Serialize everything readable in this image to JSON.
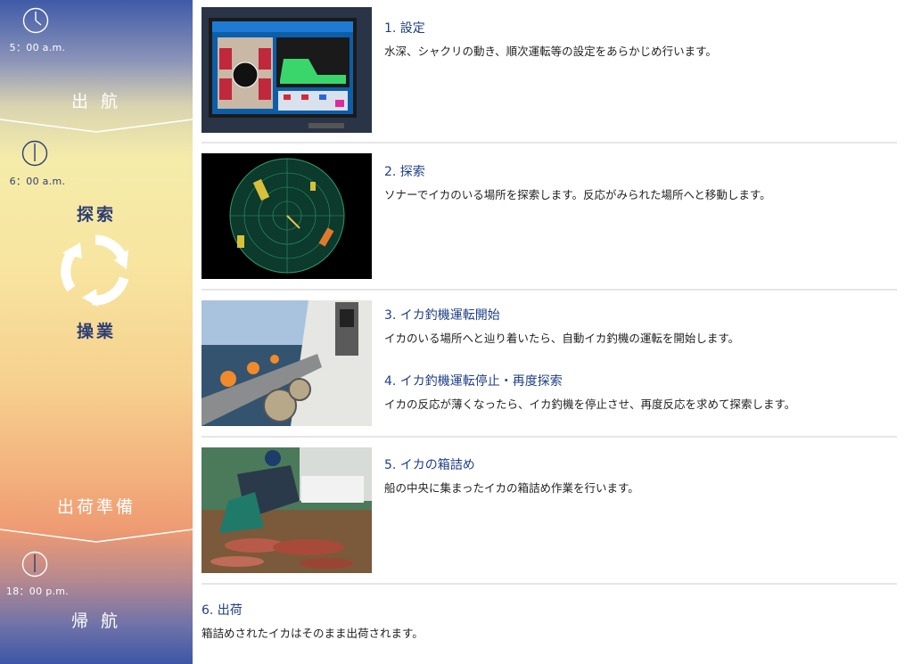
{
  "timeline": {
    "clocks": [
      {
        "time": "5：00 a.m."
      },
      {
        "time": "6：00 a.m."
      },
      {
        "time": "18：00 p.m."
      }
    ],
    "phases": {
      "departure": "出 航",
      "search": "探索",
      "operation": "操業",
      "shipping_prep": "出荷準備",
      "return": "帰 航"
    },
    "cycle_icon": "circular-arrows-icon"
  },
  "steps": [
    {
      "title": "1. 設定",
      "desc": "水深、シャクリの動き、順次運転等の設定をあらかじめ行います。"
    },
    {
      "title": "2. 探索",
      "desc": "ソナーでイカのいる場所を探索します。反応がみられた場所へと移動します。"
    },
    {
      "title": "3. イカ釣機運転開始",
      "desc": "イカのいる場所へと辿り着いたら、自動イカ釣機の運転を開始します。"
    },
    {
      "title": "4. イカ釣機運転停止・再度探索",
      "desc": "イカの反応が薄くなったら、イカ釣機を停止させ、再度反応を求めて探索します。"
    },
    {
      "title": "5. イカの箱詰め",
      "desc": "船の中央に集まったイカの箱詰め作業を行います。"
    },
    {
      "title": "6. 出荷",
      "desc": "箱詰めされたイカはそのまま出荷されます。"
    }
  ],
  "colors": {
    "title": "#1f3f86",
    "phase_dark": "#2e3e72",
    "timeline_top": "#3f5aa8",
    "timeline_bottom": "#3d56a6"
  }
}
